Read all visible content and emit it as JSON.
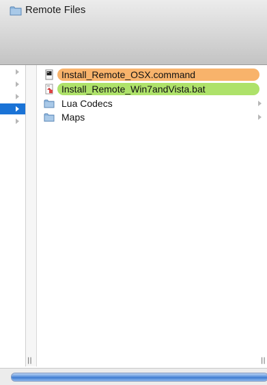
{
  "window": {
    "title": "Remote Files"
  },
  "colors": {
    "selected_row": "#1a73d6",
    "orange_label": "#f8b36b",
    "green_label": "#aee26a",
    "folder": "#8fb7de"
  },
  "left_column": {
    "rows": [
      {
        "selected": false
      },
      {
        "selected": false
      },
      {
        "selected": false
      },
      {
        "selected": true
      },
      {
        "selected": false
      }
    ]
  },
  "main_column": {
    "items": [
      {
        "label": "Install_Remote_OSX.command",
        "icon": "terminal-file-icon",
        "highlight": "orange",
        "has_children": false
      },
      {
        "label": "Install_Remote_Win7andVista.bat",
        "icon": "bat-file-icon",
        "highlight": "green",
        "has_children": false
      },
      {
        "label": "Lua Codecs",
        "icon": "folder-icon",
        "highlight": "none",
        "has_children": true
      },
      {
        "label": "Maps",
        "icon": "folder-icon",
        "highlight": "none",
        "has_children": true
      }
    ]
  },
  "scrollbar": {
    "position_fraction": 0.0,
    "visible_fraction": 1.0
  }
}
